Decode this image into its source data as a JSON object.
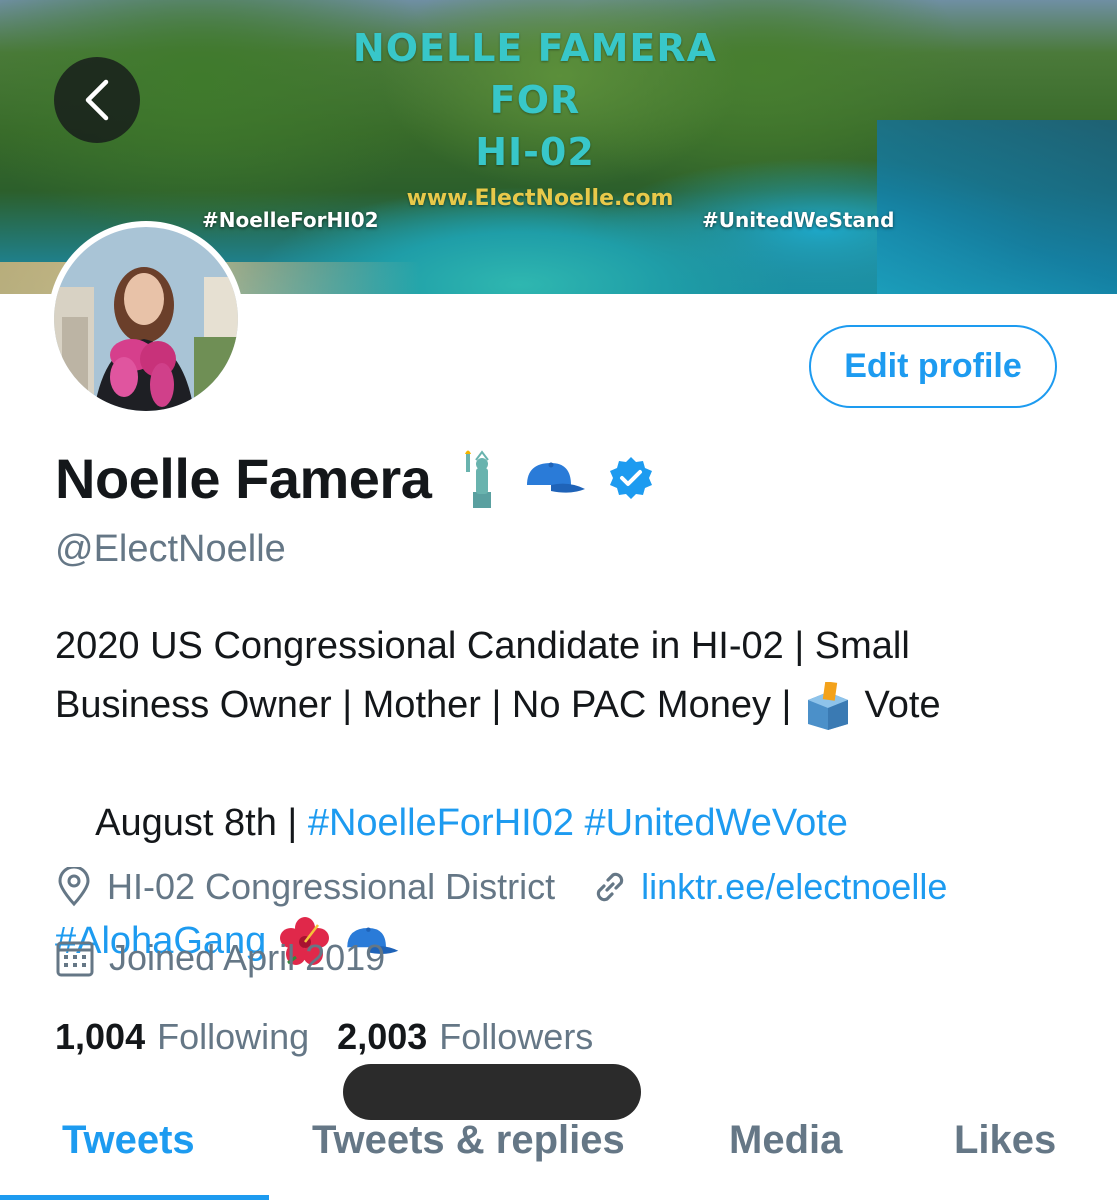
{
  "banner": {
    "title_line1": "NOELLE FAMERA",
    "title_line2": "FOR",
    "title_line3": "HI-02",
    "url": "www.ElectNoelle.com",
    "hashtag_left": "#NoelleForHI02",
    "hashtag_right": "#UnitedWeStand"
  },
  "header": {
    "edit_profile_label": "Edit profile"
  },
  "profile": {
    "name": "Noelle Famera",
    "name_emojis": [
      "statue-of-liberty",
      "blue-cap"
    ],
    "verified": true,
    "handle": "@ElectNoelle",
    "bio": {
      "line1": "2020 US Congressional Candidate in HI-02 | Small",
      "line2a": "Business Owner | Mother | No PAC Money | ",
      "line2b": " Vote",
      "line3a": "August 8th | ",
      "hashtag1": "#NoelleForHI02",
      "hashtag2": "#UnitedWeVote",
      "hashtag3": "#AlohaGang"
    },
    "location": "HI-02 Congressional District",
    "website": "linktr.ee/electnoelle",
    "joined": "Joined April 2019",
    "following_count": "1,004",
    "following_label": "Following",
    "followers_count": "2,003",
    "followers_label": "Followers"
  },
  "tabs": [
    {
      "label": "Tweets",
      "active": true
    },
    {
      "label": "Tweets & replies",
      "active": false
    },
    {
      "label": "Media",
      "active": false
    },
    {
      "label": "Likes",
      "active": false
    }
  ],
  "colors": {
    "accent": "#1d9bf0",
    "secondary_text": "#657786",
    "primary_text": "#14171a"
  }
}
